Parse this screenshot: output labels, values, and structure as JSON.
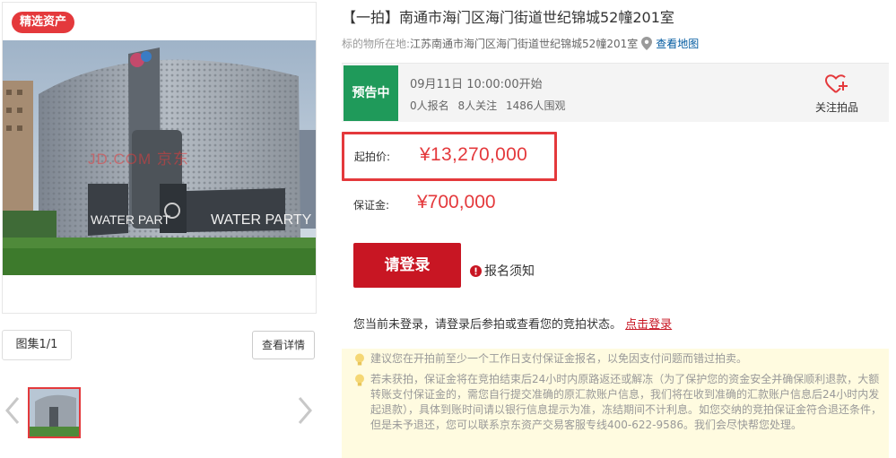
{
  "gallery": {
    "badge": "精选资产",
    "watermark": "JD.COM 京东",
    "building_sign_1": "WATER PART",
    "building_sign_2": "WATER PARTY",
    "count_label": "图集1/1",
    "details_button": "查看详情",
    "icons": {
      "prev": "chevron-left-icon",
      "next": "chevron-right-icon"
    }
  },
  "auction": {
    "title": "【一拍】南通市海门区海门街道世纪锦城52幢201室",
    "location_label": "标的物所在地:",
    "location_address": "江苏南通市海门区海门街道世纪锦城52幢201室",
    "map_link": "查看地图",
    "status": {
      "tag": "预告中",
      "start_time": "09月11日 10:00:00开始",
      "signups": "0人报名",
      "followers": "8人关注",
      "viewers": "1486人围观",
      "follow_label": "关注拍品"
    },
    "price": {
      "label": "起拍价:",
      "value": "¥13,270,000"
    },
    "deposit": {
      "label": "保证金:",
      "value": "¥700,000"
    },
    "login_button": "请登录",
    "notice_link": "报名须知",
    "login_hint_text": "您当前未登录，请登录后参拍或查看您的竞拍状态。",
    "login_hint_link": "点击登录",
    "tips": [
      "建议您在开拍前至少一个工作日支付保证金报名，以免因支付问题而错过拍卖。",
      "若未获拍，保证金将在竞拍结束后24小时内原路返还或解冻（为了保护您的资金安全并确保顺利退款，大额转账支付保证金的，需您自行提交准确的原汇款账户信息，我们将在收到准确的汇款账户信息后24小时内发起退款），具体到账时间请以银行信息提示为准，冻结期间不计利息。如您交纳的竞拍保证金符合退还条件，但是未予退还，您可以联系京东资产交易客服专线400-622-9586。我们会尽快帮您处理。"
    ]
  },
  "colors": {
    "accent_red": "#e4393c",
    "button_red": "#c81623",
    "status_green": "#1f9a5a",
    "link_blue": "#005aa0",
    "tip_bg": "#fffbe0"
  }
}
